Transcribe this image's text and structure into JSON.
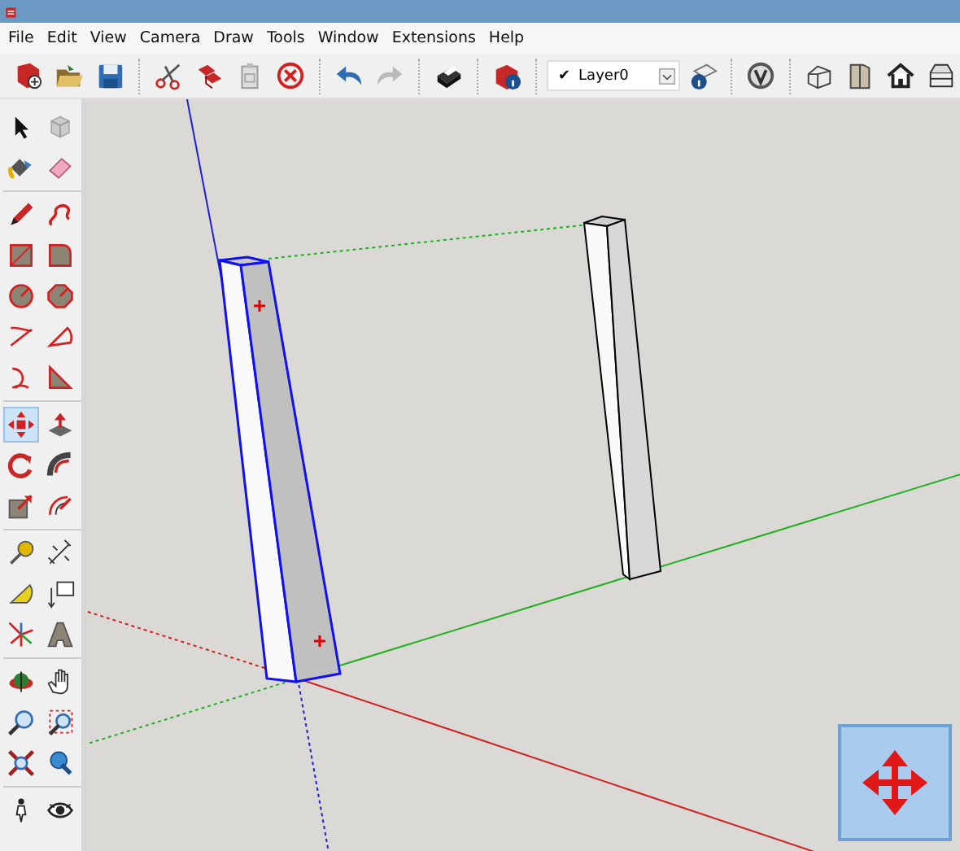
{
  "menu_bar": [
    "File",
    "Edit",
    "View",
    "Camera",
    "Draw",
    "Tools",
    "Window",
    "Extensions",
    "Help"
  ],
  "layer_selector": {
    "checkmark": "✔",
    "value": "Layer0"
  },
  "tool_palette": [
    {
      "selected": false
    },
    {
      "selected": false
    },
    {
      "selected": false
    },
    {
      "selected": false
    },
    {
      "selected": false
    },
    {
      "selected": false
    },
    {
      "selected": false
    },
    {
      "selected": false
    },
    {
      "selected": false
    },
    {
      "selected": false
    },
    {
      "selected": false
    },
    {
      "selected": false
    },
    {
      "selected": false
    },
    {
      "selected": false
    },
    {
      "selected": true
    },
    {
      "selected": false
    },
    {
      "selected": false
    },
    {
      "selected": false
    },
    {
      "selected": false
    },
    {
      "selected": false
    },
    {
      "selected": false
    },
    {
      "selected": false
    },
    {
      "selected": false
    },
    {
      "selected": false
    },
    {
      "selected": false
    },
    {
      "selected": false
    },
    {
      "selected": false
    },
    {
      "selected": false
    },
    {
      "selected": false
    },
    {
      "selected": false
    },
    {
      "selected": false
    },
    {
      "selected": false
    },
    {
      "selected": false
    },
    {
      "selected": false
    }
  ]
}
